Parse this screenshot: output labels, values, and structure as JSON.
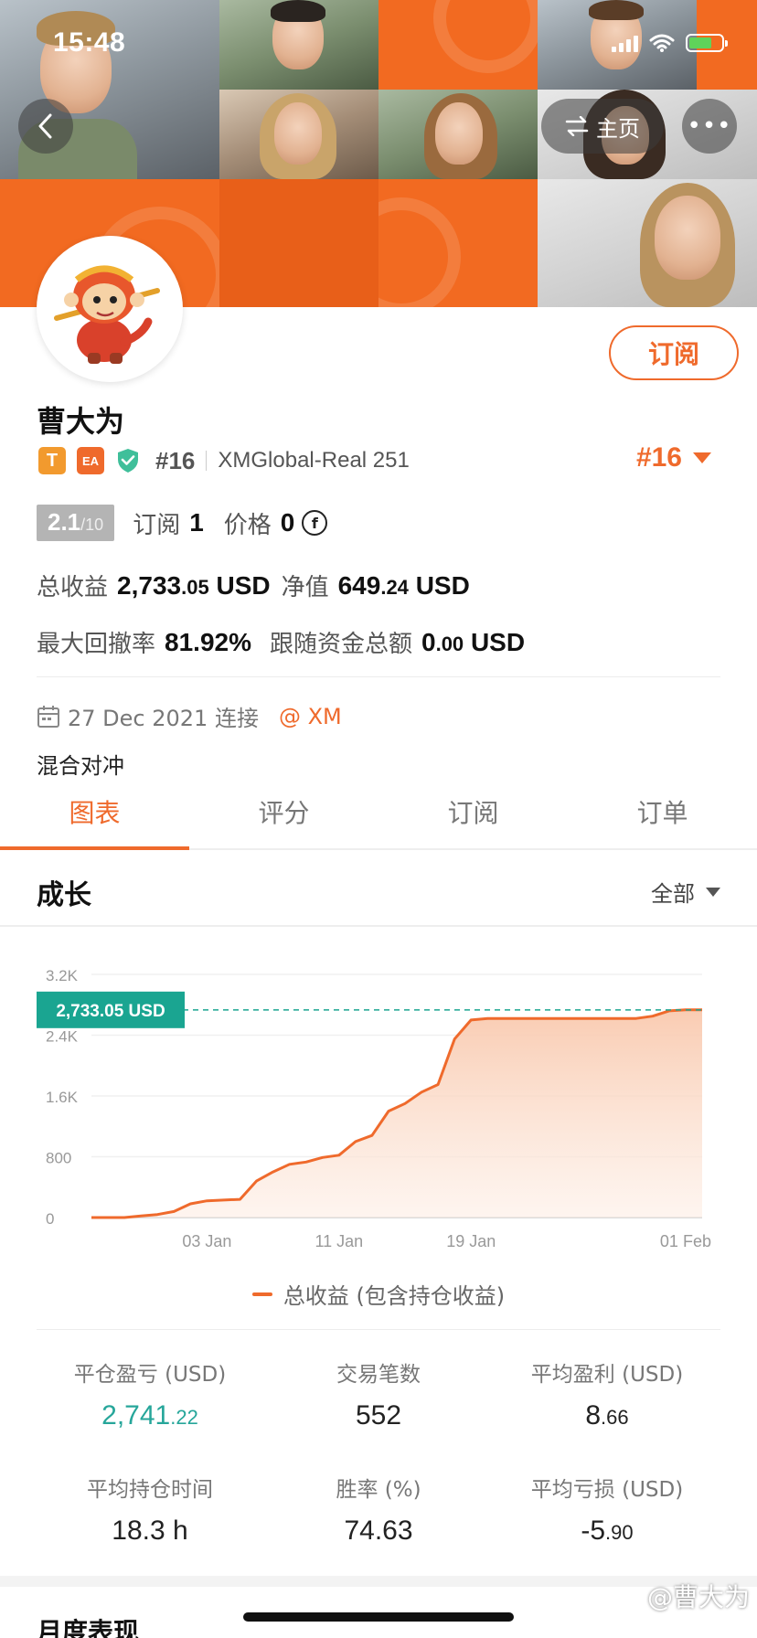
{
  "status_bar": {
    "time": "15:48"
  },
  "nav": {
    "home_label": "主页",
    "more_label": "•••"
  },
  "profile": {
    "name": "曹大为",
    "subscribe_label": "订阅",
    "tag_t": "T",
    "tag_ea": "EA",
    "rank_small": "#16",
    "account": "XMGlobal-Real 251",
    "rank_big": "#16",
    "score": "2.1",
    "score_denominator": "/10",
    "subscribe_count_label": "订阅",
    "subscribe_count": "1",
    "price_label": "价格",
    "price_value": "0",
    "coin_symbol": "f",
    "total_profit_label": "总收益",
    "total_profit_int": "2,733",
    "total_profit_dec": ".05",
    "total_profit_unit": "USD",
    "equity_label": "净值",
    "equity_int": "649",
    "equity_dec": ".24",
    "equity_unit": "USD",
    "max_drawdown_label": "最大回撤率",
    "max_drawdown": "81.92%",
    "follow_funds_label": "跟随资金总额",
    "follow_funds_int": "0",
    "follow_funds_dec": ".00",
    "follow_funds_unit": "USD",
    "connected_date": "27 Dec 2021 连接",
    "broker": "@ XM",
    "strategy": "混合对冲"
  },
  "tabs": [
    {
      "label": "图表",
      "active": true
    },
    {
      "label": "评分",
      "active": false
    },
    {
      "label": "订阅",
      "active": false
    },
    {
      "label": "订单",
      "active": false
    }
  ],
  "section": {
    "title": "成长",
    "range": "全部"
  },
  "chart_data": {
    "type": "area",
    "x": [
      "2021-12-27",
      "2021-12-28",
      "2021-12-29",
      "2021-12-30",
      "2021-12-31",
      "2022-01-01",
      "2022-01-02",
      "2022-01-03",
      "2022-01-04",
      "2022-01-05",
      "2022-01-06",
      "2022-01-07",
      "2022-01-08",
      "2022-01-09",
      "2022-01-10",
      "2022-01-11",
      "2022-01-12",
      "2022-01-13",
      "2022-01-14",
      "2022-01-15",
      "2022-01-16",
      "2022-01-17",
      "2022-01-18",
      "2022-01-19",
      "2022-01-20",
      "2022-01-21",
      "2022-01-22",
      "2022-01-23",
      "2022-01-24",
      "2022-01-25",
      "2022-01-26",
      "2022-01-27",
      "2022-01-28",
      "2022-01-29",
      "2022-01-30",
      "2022-01-31",
      "2022-02-01",
      "2022-02-02"
    ],
    "series": [
      {
        "name": "总收益 (包含持仓收益)",
        "values": [
          0,
          0,
          0,
          20,
          40,
          80,
          180,
          220,
          230,
          240,
          480,
          600,
          700,
          730,
          790,
          820,
          1000,
          1080,
          1400,
          1500,
          1650,
          1750,
          2350,
          2600,
          2620,
          2620,
          2620,
          2620,
          2620,
          2620,
          2620,
          2620,
          2620,
          2620,
          2650,
          2720,
          2733.05,
          2733.05
        ]
      }
    ],
    "y_ticks": [
      "0",
      "800",
      "1.6K",
      "2.4K",
      "3.2K"
    ],
    "y_tick_values": [
      0,
      800,
      1600,
      2400,
      3200
    ],
    "x_ticks": [
      "03 Jan",
      "11 Jan",
      "19 Jan",
      "01 Feb"
    ],
    "x_tick_dates": [
      "2022-01-03",
      "2022-01-11",
      "2022-01-19",
      "2022-02-01"
    ],
    "ylim": [
      0,
      3200
    ],
    "current_value": 2733.05,
    "current_label": "2,733.05 USD",
    "colors": {
      "line": "#ef6a2c",
      "fill": "#fbd9c7",
      "marker": "#1aa591"
    }
  },
  "legend": {
    "label": "总收益 (包含持仓收益)"
  },
  "stats": [
    {
      "label": "平仓盈亏 (USD)",
      "int": "2,741",
      "dec": ".22",
      "green": true
    },
    {
      "label": "交易笔数",
      "int": "552",
      "dec": "",
      "green": false
    },
    {
      "label": "平均盈利 (USD)",
      "int": "8",
      "dec": ".66",
      "green": false
    },
    {
      "label": "平均持仓时间",
      "int": "18.3 h",
      "dec": "",
      "green": false
    },
    {
      "label": "胜率 (%)",
      "int": "74.63",
      "dec": "",
      "green": false
    },
    {
      "label": "平均亏损 (USD)",
      "int": "-5",
      "dec": ".90",
      "green": false
    }
  ],
  "footer": {
    "title": "月度表现",
    "watermark": "@曹大为"
  }
}
